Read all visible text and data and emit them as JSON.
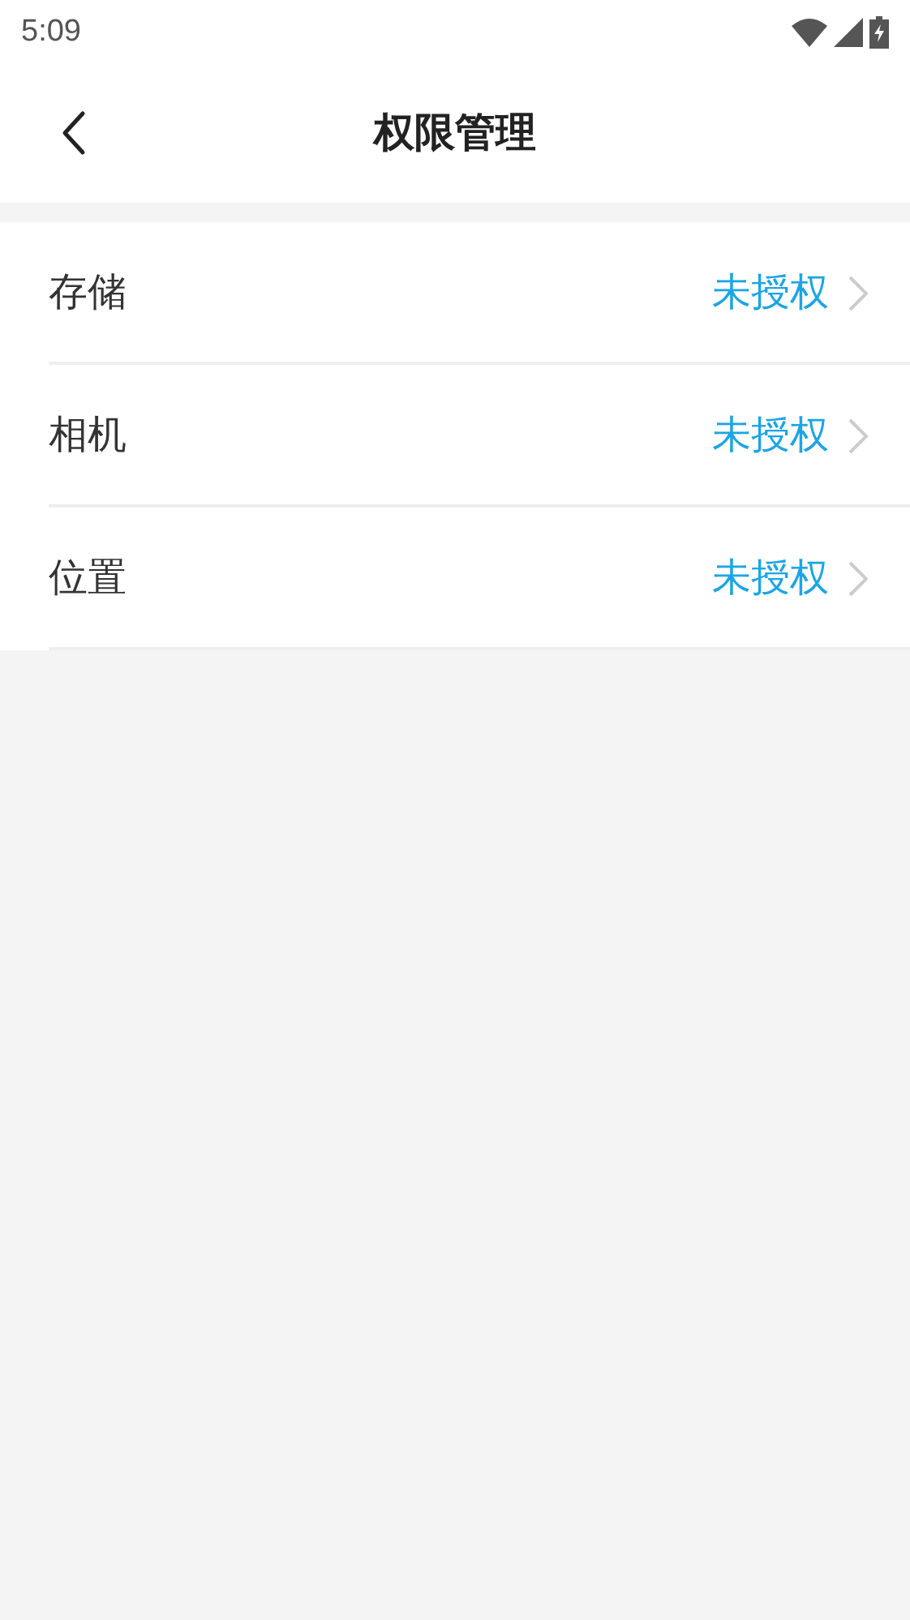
{
  "status_bar": {
    "time": "5:09"
  },
  "header": {
    "title": "权限管理"
  },
  "permissions": [
    {
      "name": "存储",
      "status": "未授权"
    },
    {
      "name": "相机",
      "status": "未授权"
    },
    {
      "name": "位置",
      "status": "未授权"
    }
  ]
}
